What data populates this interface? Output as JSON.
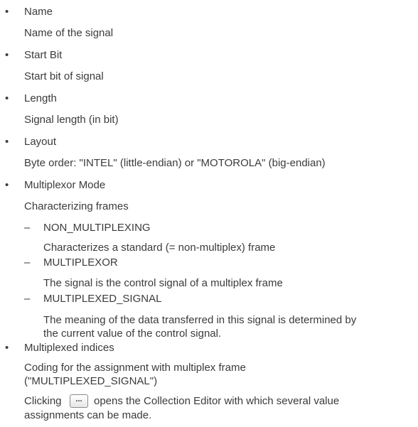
{
  "items": [
    {
      "term": "Name",
      "desc": "Name of the signal"
    },
    {
      "term": "Start Bit",
      "desc": "Start bit of signal"
    },
    {
      "term": "Length",
      "desc": "Signal length (in bit)"
    },
    {
      "term": "Layout",
      "desc": "Byte order: \"INTEL\" (little-endian) or \"MOTOROLA\" (big-endian)"
    },
    {
      "term": "Multiplexor Mode",
      "desc": "Characterizing frames"
    }
  ],
  "modes": [
    {
      "term": "NON_MULTIPLEXING",
      "desc": "Characterizes a standard (= non-multiplex) frame"
    },
    {
      "term": "MULTIPLEXOR",
      "desc": "The signal is the control signal of a multiplex frame"
    },
    {
      "term": "MULTIPLEXED_SIGNAL",
      "desc_line1": "The meaning of the data transferred in this signal is determined by",
      "desc_line2": "the current value of the control signal."
    }
  ],
  "indices": {
    "term": "Multiplexed indices",
    "desc_line1": "Coding for the assignment with multiplex frame",
    "desc_line2": "(\"MULTIPLEXED_SIGNAL\")",
    "click_prefix": "Clicking",
    "button_label": "...",
    "click_suffix": "opens the Collection Editor with which several value",
    "click_line2": "assignments can be made."
  },
  "bullet_glyph": "•",
  "dash_glyph": "–"
}
